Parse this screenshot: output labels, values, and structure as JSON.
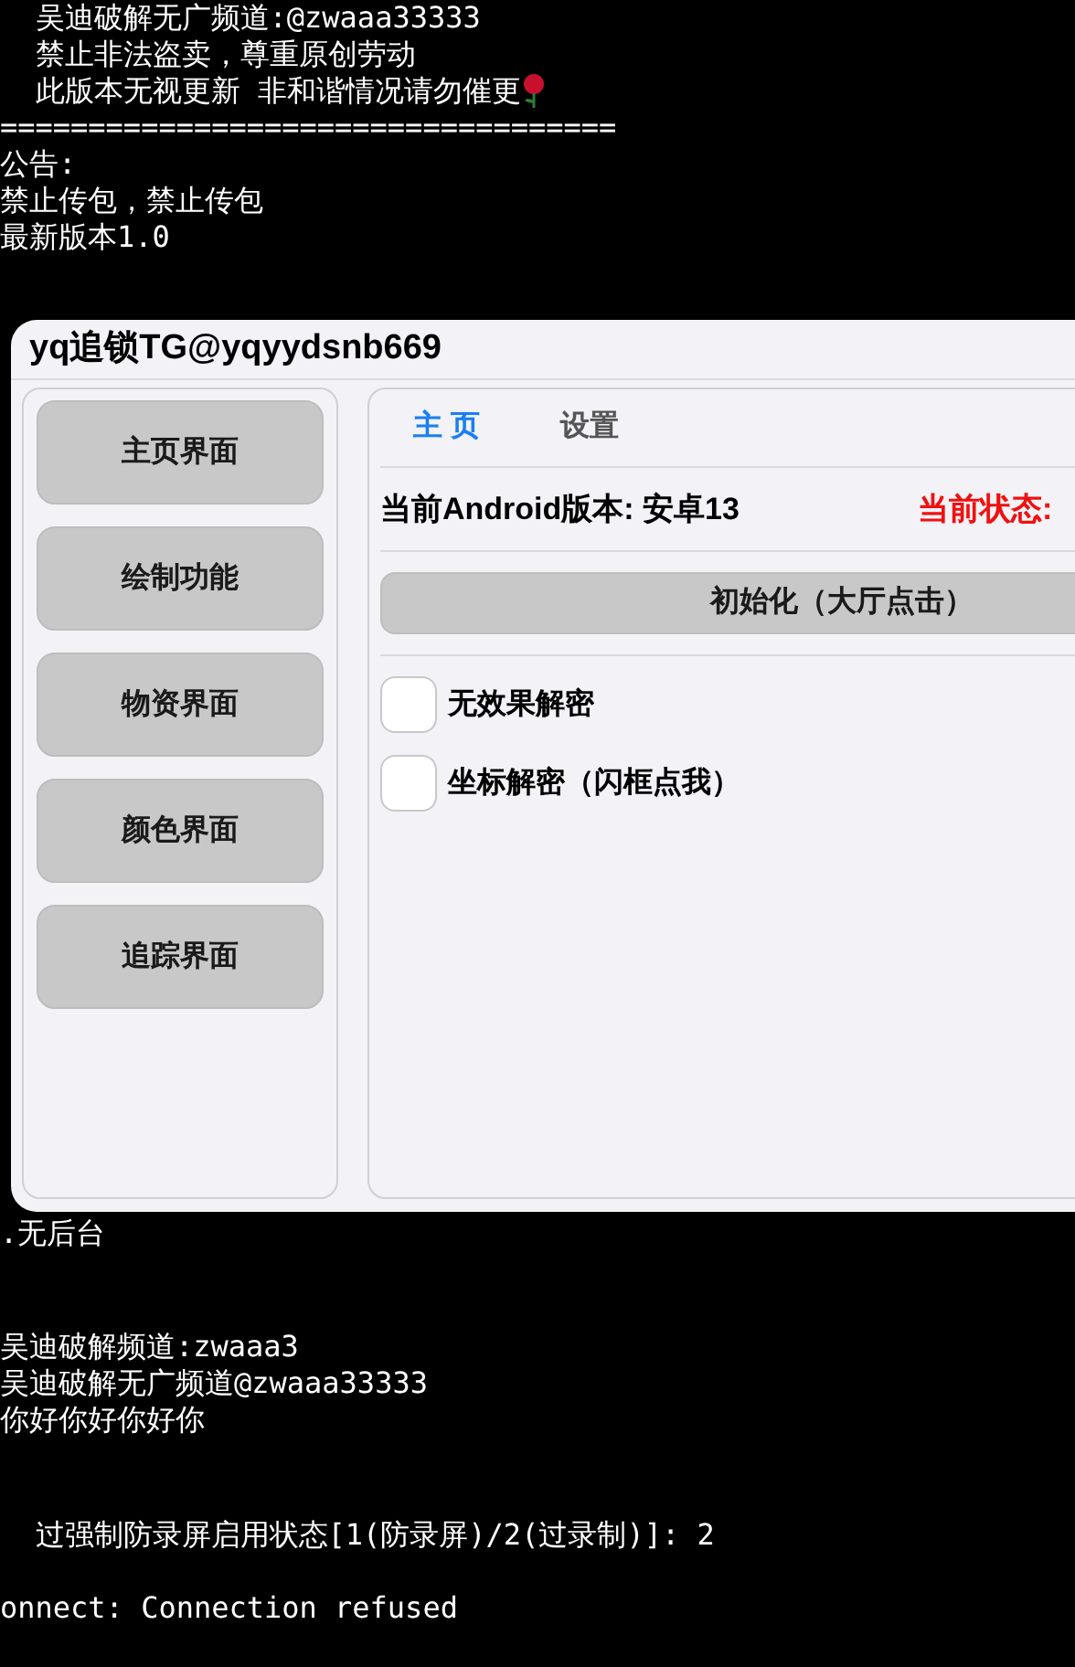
{
  "terminal_top": [
    {
      "text": "  吴迪破解无广频道:@zwaaa33333"
    },
    {
      "text": "  禁止非法盗卖，尊重原创劳动"
    },
    {
      "text": "  此版本无视更新 非和谐情况请勿催更"
    },
    {
      "text": "==================================="
    },
    {
      "text": "公告:"
    },
    {
      "text": "禁止传包，禁止传包"
    },
    {
      "text": "最新版本1.0"
    }
  ],
  "window": {
    "title": "yq追锁TG@yqyydsnb669",
    "sidebar": [
      {
        "label": "主页界面"
      },
      {
        "label": "绘制功能"
      },
      {
        "label": "物资界面"
      },
      {
        "label": "颜色界面"
      },
      {
        "label": "追踪界面"
      }
    ],
    "tabs": [
      {
        "label": "主 页",
        "selected": true
      },
      {
        "label": "设置",
        "selected": false
      }
    ],
    "android_version": "当前Android版本: 安卓13",
    "status_label": "当前状态:",
    "init_button": "初始化（大厅点击）",
    "checkboxes": [
      {
        "label": "无效果解密",
        "checked": false
      },
      {
        "label": "坐标解密（闪框点我）",
        "checked": false
      }
    ]
  },
  "terminal_bottom": [
    {
      "text": ".无后台"
    },
    {
      "text": "吴迪破解频道:zwaaa3"
    },
    {
      "text": "吴迪破解无广频道@zwaaa33333"
    },
    {
      "text": "你好你好你好你"
    },
    {
      "text": "  过强制防录屏启用状态[1(防录屏)/2(过录制)]: 2"
    },
    {
      "text": "onnect: Connection refused"
    }
  ]
}
